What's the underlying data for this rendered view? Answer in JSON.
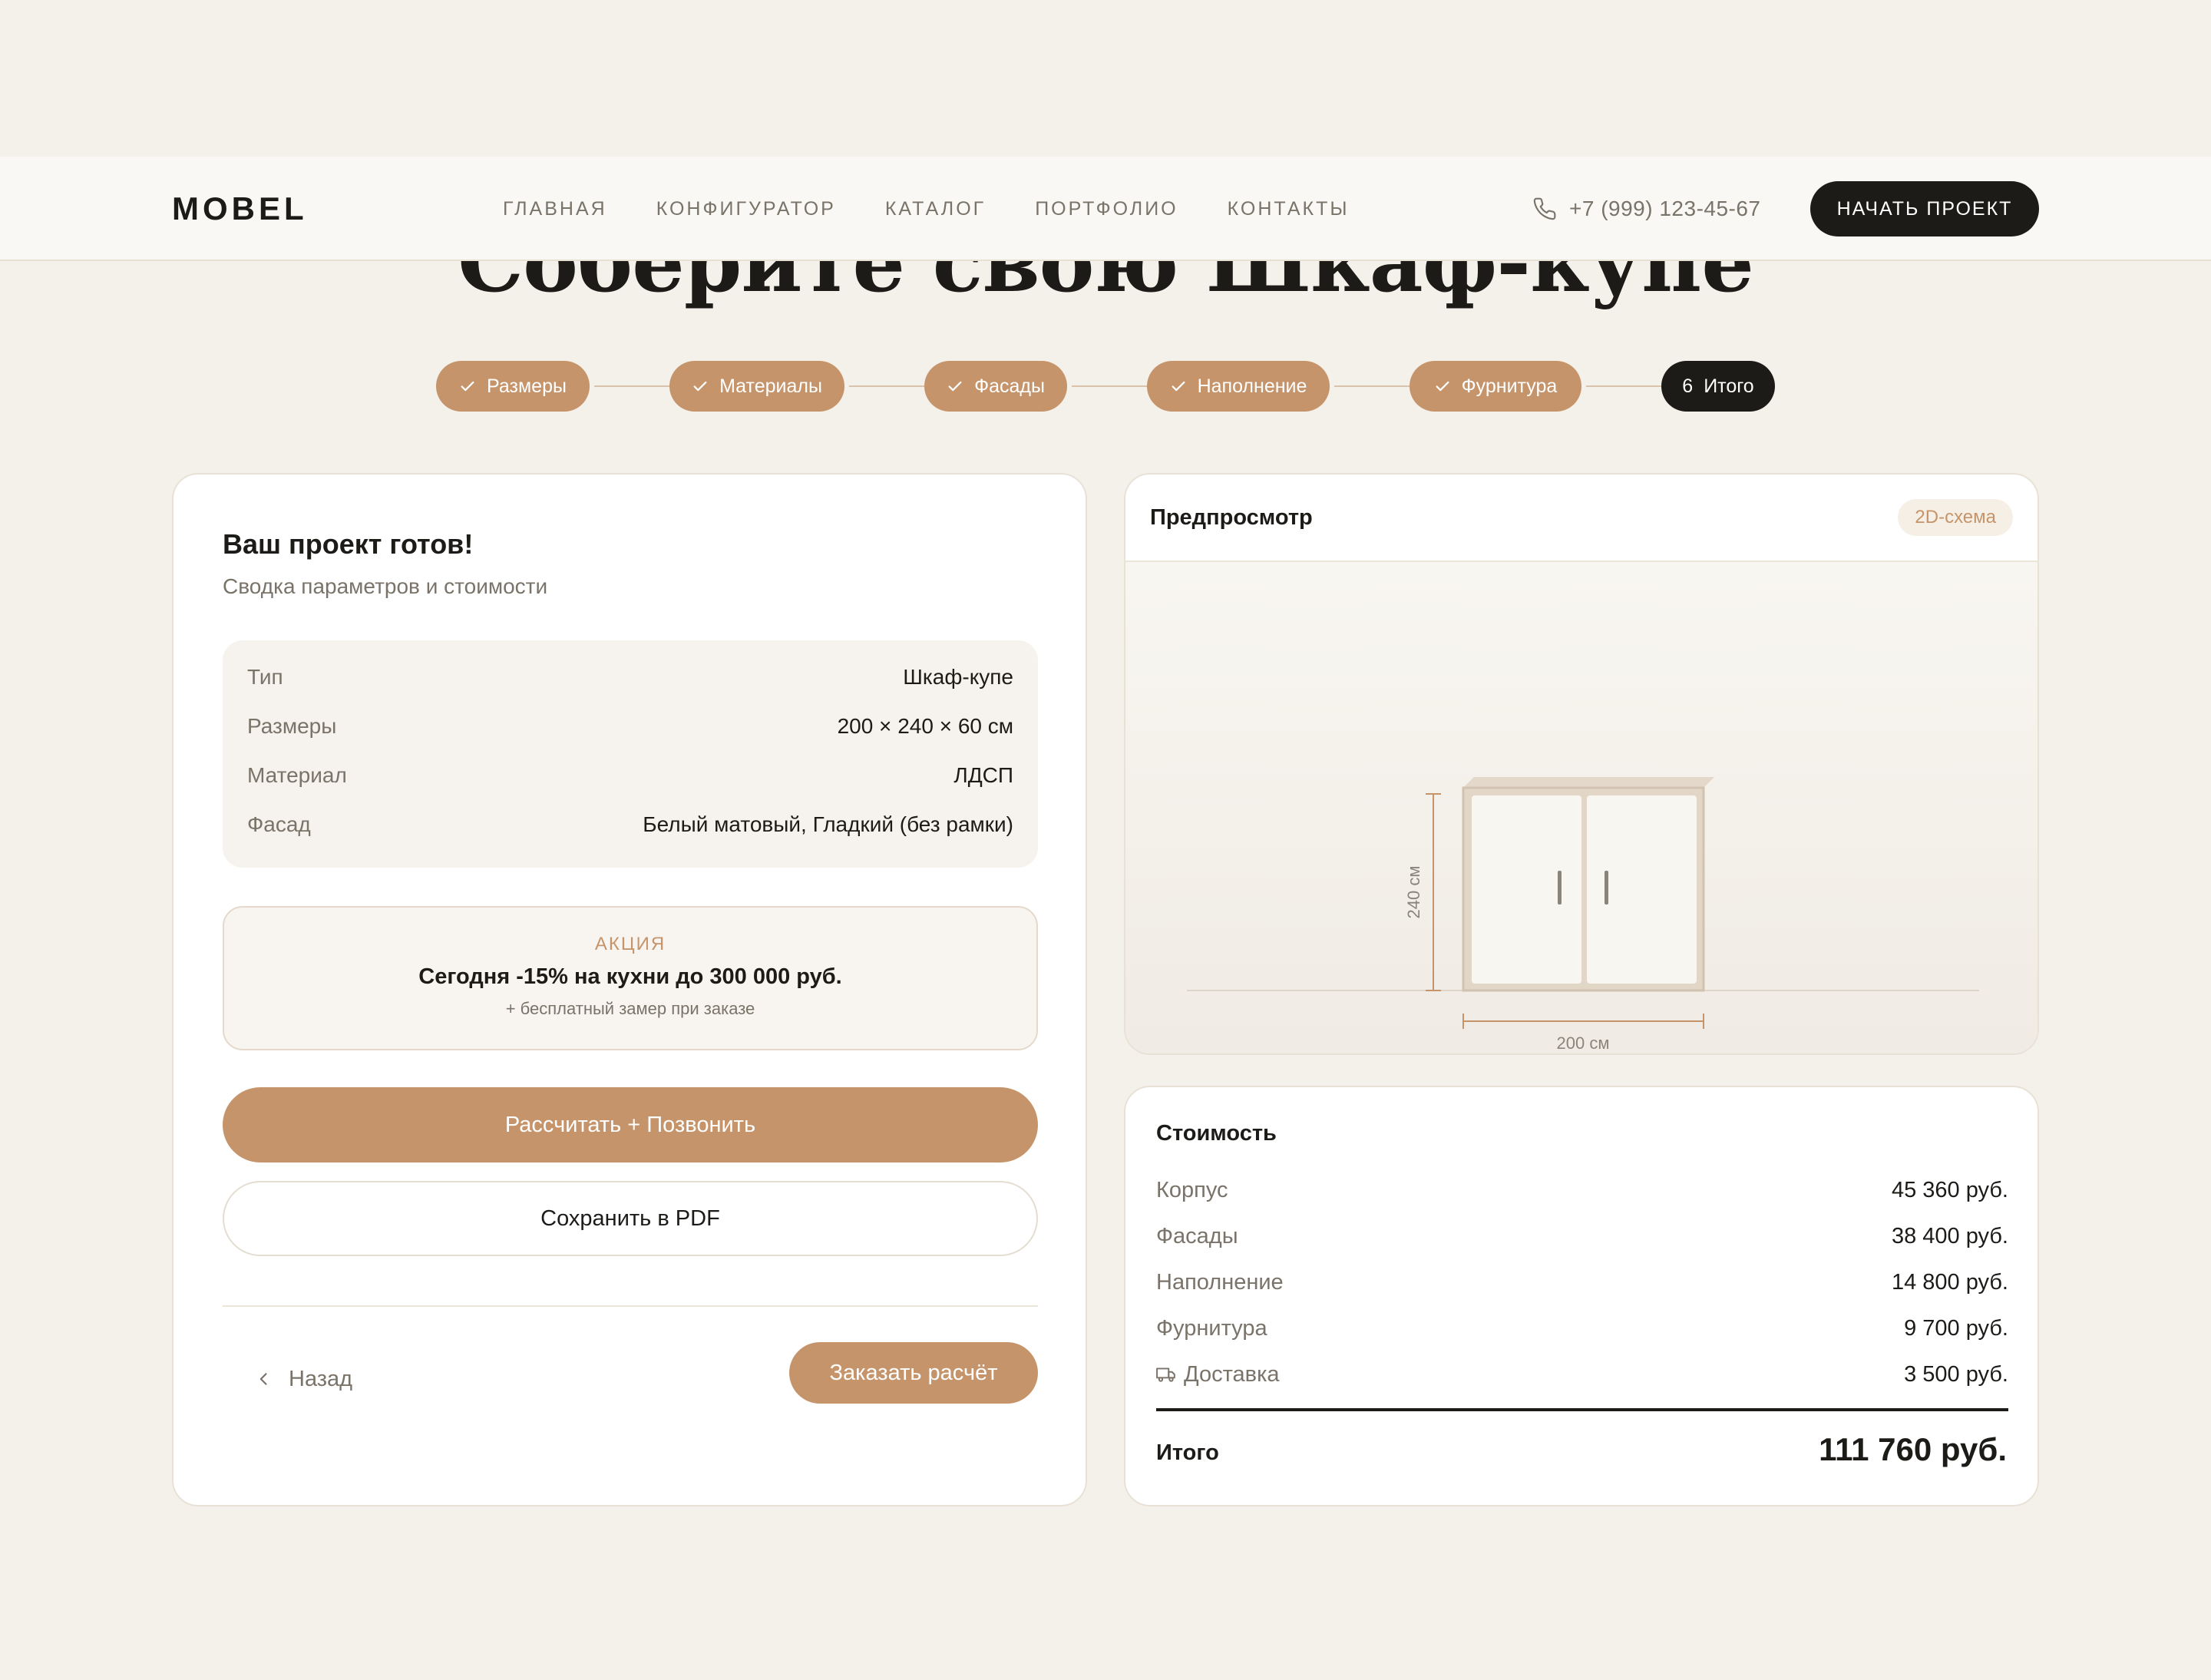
{
  "page": {
    "title": "Соберите свою Шкаф-купе"
  },
  "header": {
    "logo": "MOBEL",
    "nav": [
      "ГЛАВНАЯ",
      "КОНФИГУРАТОР",
      "КАТАЛОГ",
      "ПОРТФОЛИО",
      "КОНТАКТЫ"
    ],
    "phone": "+7 (999) 123-45-67",
    "cta": "НАЧАТЬ ПРОЕКТ"
  },
  "stepper": {
    "steps": [
      {
        "label": "Размеры",
        "state": "done"
      },
      {
        "label": "Материалы",
        "state": "done"
      },
      {
        "label": "Фасады",
        "state": "done"
      },
      {
        "label": "Наполнение",
        "state": "done"
      },
      {
        "label": "Фурнитура",
        "state": "done"
      },
      {
        "label": "Итого",
        "number": "6",
        "state": "active"
      }
    ]
  },
  "project": {
    "title": "Ваш проект готов!",
    "subtitle": "Сводка параметров и стоимости",
    "summary": [
      {
        "key": "Тип",
        "value": "Шкаф-купе"
      },
      {
        "key": "Размеры",
        "value": "200 × 240 × 60 см"
      },
      {
        "key": "Материал",
        "value": "ЛДСП"
      },
      {
        "key": "Фасад",
        "value": "Белый матовый, Гладкий (без рамки)"
      }
    ],
    "promo": {
      "tag": "АКЦИЯ",
      "title": "Сегодня -15% на кухни до 300 000 руб.",
      "note": "+ бесплатный замер при заказе"
    },
    "primary_button": "Рассчитать + Позвонить",
    "pdf_button": "Сохранить в PDF",
    "back_label": "Назад",
    "order_button": "Заказать расчёт"
  },
  "preview": {
    "title": "Предпросмотр",
    "badge": "2D-схема",
    "height_label": "240 см",
    "width_label": "200 см"
  },
  "cost": {
    "title": "Стоимость",
    "rows": [
      {
        "key": "Корпус",
        "value": "45 360 руб."
      },
      {
        "key": "Фасады",
        "value": "38 400 руб."
      },
      {
        "key": "Наполнение",
        "value": "14 800 руб."
      },
      {
        "key": "Фурнитура",
        "value": "9 700 руб."
      },
      {
        "key": "Доставка",
        "value": "3 500 руб.",
        "icon": "truck-icon"
      }
    ],
    "total_label": "Итого",
    "total_value": "111 760 руб."
  },
  "colors": {
    "background": "#f4f1eb",
    "accent": "#c6946a",
    "dark": "#1d1b18",
    "muted": "#7a7369"
  }
}
